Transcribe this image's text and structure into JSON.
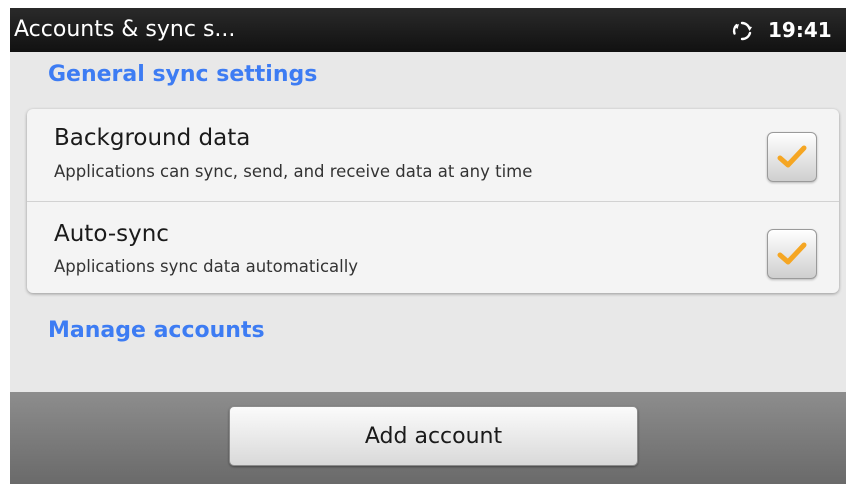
{
  "status_bar": {
    "title": "Accounts & sync s...",
    "sync_icon": "sync-icon",
    "time": "19:41"
  },
  "sections": {
    "general_header": "General sync settings",
    "manage_header": "Manage accounts"
  },
  "preferences": [
    {
      "title": "Background data",
      "summary": "Applications can sync, send, and receive data at any time",
      "checked": true
    },
    {
      "title": "Auto-sync",
      "summary": "Applications sync data automatically",
      "checked": true
    }
  ],
  "bottom_bar": {
    "add_account_label": "Add account"
  },
  "colors": {
    "accent": "#3d7cf3",
    "checkmark": "#f5a623",
    "status_bar": "#1a1a1a"
  }
}
